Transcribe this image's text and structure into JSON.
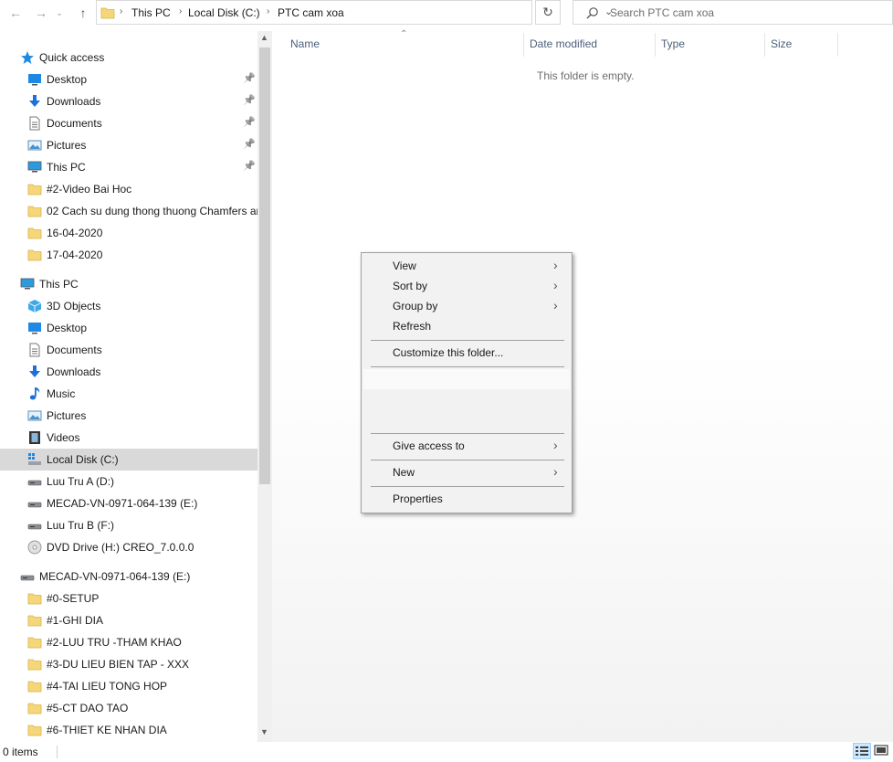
{
  "address": {
    "crumbs": [
      "This PC",
      "Local Disk (C:)",
      "PTC cam xoa"
    ],
    "separator": "›"
  },
  "search": {
    "placeholder": "Search PTC cam xoa"
  },
  "nav": {
    "quick_access": {
      "label": "Quick access",
      "items": [
        {
          "label": "Desktop",
          "icon": "desktop-icon",
          "pinned": true
        },
        {
          "label": "Downloads",
          "icon": "downloads-icon",
          "pinned": true
        },
        {
          "label": "Documents",
          "icon": "documents-icon",
          "pinned": true
        },
        {
          "label": "Pictures",
          "icon": "pictures-icon",
          "pinned": true
        },
        {
          "label": "This PC",
          "icon": "pc-icon",
          "pinned": true
        },
        {
          "label": "#2-Video Bai Hoc",
          "icon": "folder-icon",
          "pinned": false
        },
        {
          "label": "02 Cach su dung thong thuong Chamfers ar",
          "icon": "folder-icon",
          "pinned": false
        },
        {
          "label": "16-04-2020",
          "icon": "folder-icon",
          "pinned": false
        },
        {
          "label": "17-04-2020",
          "icon": "folder-icon",
          "pinned": false
        }
      ]
    },
    "this_pc": {
      "label": "This PC",
      "items": [
        {
          "label": "3D Objects",
          "icon": "3d-objects-icon"
        },
        {
          "label": "Desktop",
          "icon": "desktop-icon"
        },
        {
          "label": "Documents",
          "icon": "documents-icon"
        },
        {
          "label": "Downloads",
          "icon": "downloads-icon"
        },
        {
          "label": "Music",
          "icon": "music-icon"
        },
        {
          "label": "Pictures",
          "icon": "pictures-icon"
        },
        {
          "label": "Videos",
          "icon": "videos-icon"
        },
        {
          "label": "Local Disk (C:)",
          "icon": "windows-drive-icon",
          "selected": true
        },
        {
          "label": "Luu Tru A (D:)",
          "icon": "drive-icon"
        },
        {
          "label": "MECAD-VN-0971-064-139 (E:)",
          "icon": "drive-icon"
        },
        {
          "label": "Luu Tru B (F:)",
          "icon": "drive-icon"
        },
        {
          "label": "DVD Drive (H:) CREO_7.0.0.0",
          "icon": "dvd-icon"
        }
      ]
    },
    "drive_e": {
      "label": "MECAD-VN-0971-064-139 (E:)",
      "items": [
        {
          "label": "#0-SETUP",
          "icon": "folder-icon"
        },
        {
          "label": "#1-GHI DIA",
          "icon": "folder-icon"
        },
        {
          "label": "#2-LUU TRU -THAM KHAO",
          "icon": "folder-icon"
        },
        {
          "label": "#3-DU LIEU BIEN TAP - XXX",
          "icon": "folder-icon"
        },
        {
          "label": "#4-TAI LIEU TONG HOP",
          "icon": "folder-icon"
        },
        {
          "label": "#5-CT DAO TAO",
          "icon": "folder-icon"
        },
        {
          "label": "#6-THIET KE NHAN DIA",
          "icon": "folder-icon"
        }
      ]
    }
  },
  "columns": [
    "Name",
    "Date modified",
    "Type",
    "Size"
  ],
  "empty_text": "This folder is empty.",
  "context_menu": {
    "items": [
      {
        "label": "View",
        "submenu": true
      },
      {
        "label": "Sort by",
        "submenu": true
      },
      {
        "label": "Group by",
        "submenu": true
      },
      {
        "label": "Refresh",
        "submenu": false
      },
      {
        "label": "Customize this folder...",
        "submenu": false
      },
      {
        "label": "Give access to",
        "submenu": true
      },
      {
        "label": "New",
        "submenu": true
      },
      {
        "label": "Properties",
        "submenu": false
      }
    ]
  },
  "status": {
    "count": "0 items"
  }
}
